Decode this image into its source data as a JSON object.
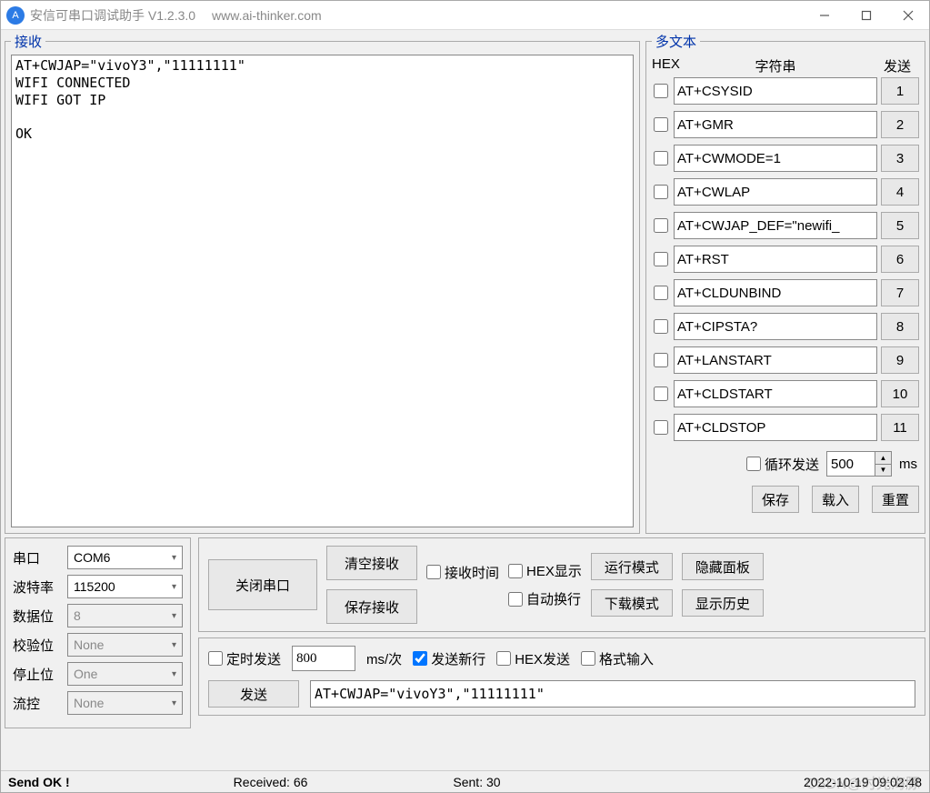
{
  "titlebar": {
    "icon_text": "A",
    "title": "安信可串口调试助手 V1.2.3.0",
    "url": "www.ai-thinker.com"
  },
  "receive": {
    "legend": "接收",
    "content": "AT+CWJAP=\"vivoY3\",\"11111111\"\nWIFI CONNECTED\nWIFI GOT IP\n\nOK"
  },
  "multi": {
    "legend": "多文本",
    "header_hex": "HEX",
    "header_str": "字符串",
    "header_send": "发送",
    "rows": [
      {
        "cmd": "AT+CSYSID",
        "btn": "1"
      },
      {
        "cmd": "AT+GMR",
        "btn": "2"
      },
      {
        "cmd": "AT+CWMODE=1",
        "btn": "3"
      },
      {
        "cmd": "AT+CWLAP",
        "btn": "4"
      },
      {
        "cmd": "AT+CWJAP_DEF=\"newifi_",
        "btn": "5"
      },
      {
        "cmd": "AT+RST",
        "btn": "6"
      },
      {
        "cmd": "AT+CLDUNBIND",
        "btn": "7"
      },
      {
        "cmd": "AT+CIPSTA?",
        "btn": "8"
      },
      {
        "cmd": "AT+LANSTART",
        "btn": "9"
      },
      {
        "cmd": "AT+CLDSTART",
        "btn": "10"
      },
      {
        "cmd": "AT+CLDSTOP",
        "btn": "11"
      }
    ],
    "loop_label": "循环发送",
    "loop_value": "500",
    "loop_unit": "ms",
    "save_label": "保存",
    "load_label": "载入",
    "reset_label": "重置"
  },
  "port": {
    "rows": [
      {
        "label": "串口",
        "value": "COM6",
        "disabled": false
      },
      {
        "label": "波特率",
        "value": "115200",
        "disabled": false
      },
      {
        "label": "数据位",
        "value": "8",
        "disabled": true
      },
      {
        "label": "校验位",
        "value": "None",
        "disabled": true
      },
      {
        "label": "停止位",
        "value": "One",
        "disabled": true
      },
      {
        "label": "流控",
        "value": "None",
        "disabled": true
      }
    ]
  },
  "controls": {
    "close_port": "关闭串口",
    "clear_recv": "清空接收",
    "save_recv": "保存接收",
    "recv_time": "接收时间",
    "hex_display": "HEX显示",
    "auto_wrap": "自动换行",
    "run_mode": "运行模式",
    "download_mode": "下载模式",
    "hide_panel": "隐藏面板",
    "show_history": "显示历史"
  },
  "send": {
    "timed_send": "定时发送",
    "interval": "800",
    "interval_unit": "ms/次",
    "send_newline": "发送新行",
    "hex_send": "HEX发送",
    "format_input": "格式输入",
    "send_btn": "发送",
    "send_value": "AT+CWJAP=\"vivoY3\",\"11111111\""
  },
  "status": {
    "send_ok": "Send OK !",
    "received": "Received: 66",
    "sent": "Sent: 30",
    "timestamp": "2022-10-19 09:02:48",
    "watermark": "CSDN@时光海豚"
  }
}
